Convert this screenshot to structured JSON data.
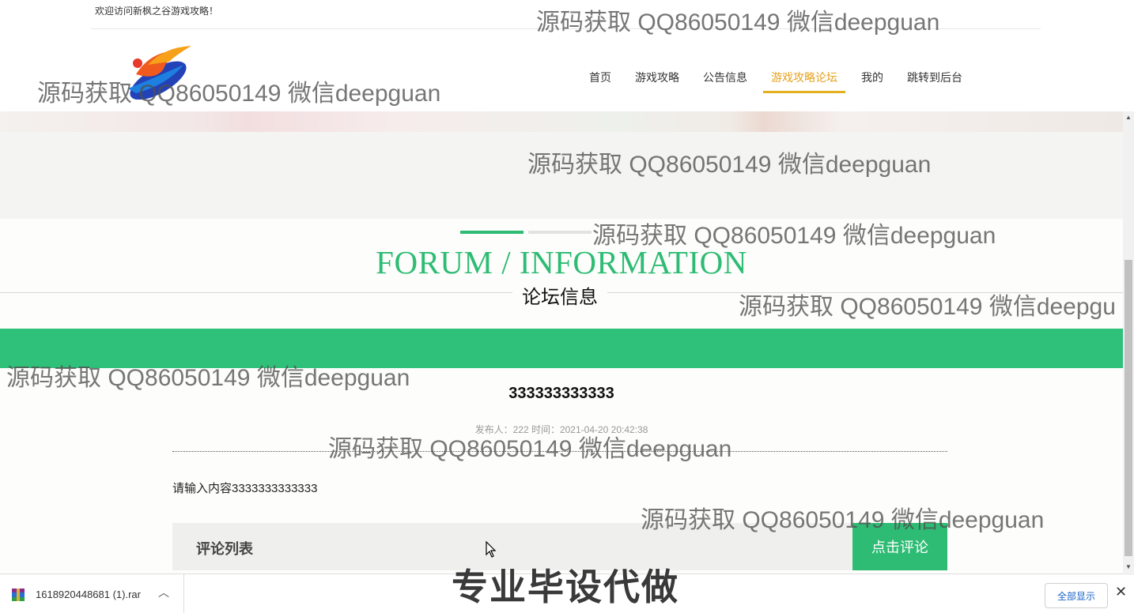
{
  "header": {
    "welcome_text": "欢迎访问新枫之谷游戏攻略！",
    "nav": [
      {
        "label": "首页",
        "active": false
      },
      {
        "label": "游戏攻略",
        "active": false
      },
      {
        "label": "公告信息",
        "active": false
      },
      {
        "label": "游戏攻略论坛",
        "active": true
      },
      {
        "label": "我的",
        "active": false
      },
      {
        "label": "跳转到后台",
        "active": false
      }
    ],
    "accent_color": "#e5a21b"
  },
  "section": {
    "title_en": "FORUM / INFORMATION",
    "title_cn": "论坛信息",
    "brand_color": "#2ebc74"
  },
  "post": {
    "title": "333333333333",
    "meta": "发布人：222 时间：2021-04-20 20:42:38",
    "content": "请输入内容3333333333333"
  },
  "comments": {
    "list_title": "评论列表",
    "comment_button": "点击评论"
  },
  "download_bar": {
    "file_name": "1618920448681 (1).rar",
    "show_all": "全部显示"
  },
  "overlay": {
    "watermark": "源码获取 QQ86050149 微信deepguan",
    "watermark_cut": "源码获取 QQ86050149 微信deepgu",
    "promo": "专业毕设代做"
  }
}
